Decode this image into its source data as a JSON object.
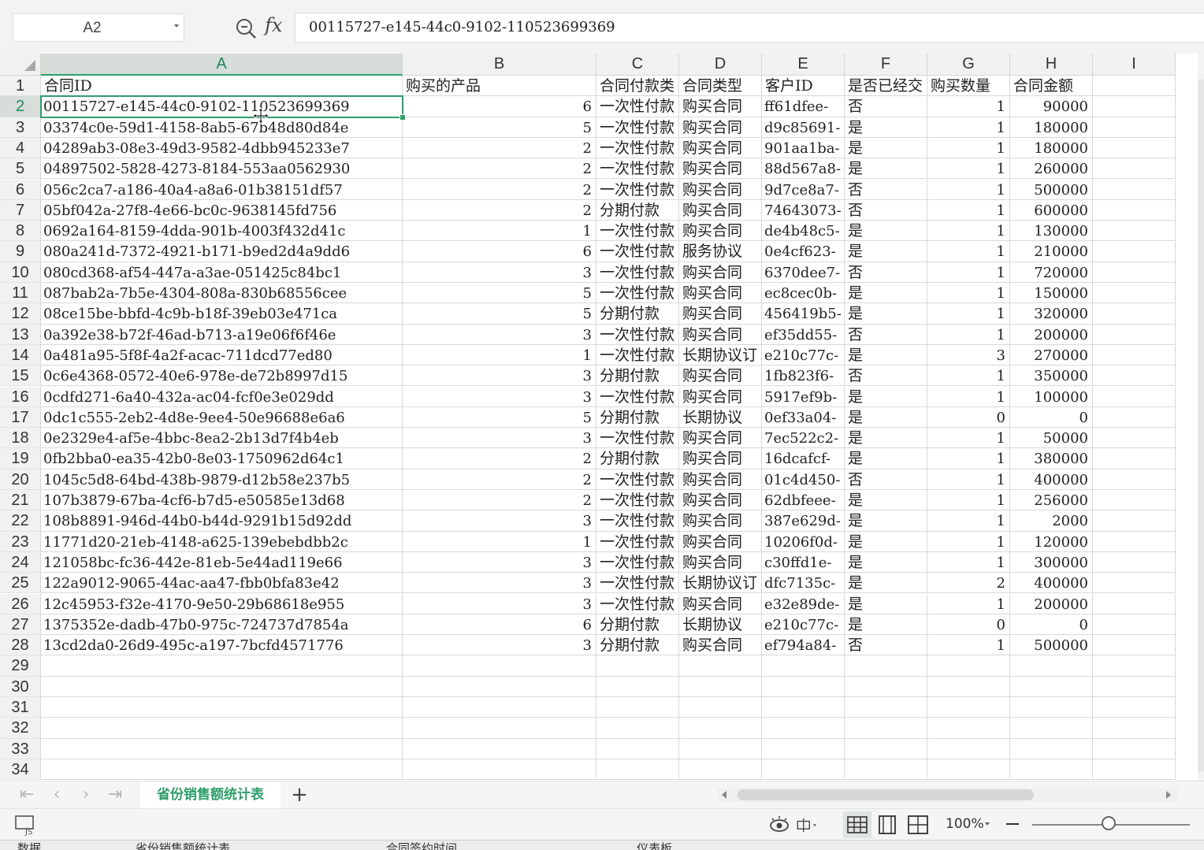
{
  "formula_bar": {
    "cell_ref": "A2",
    "fx_label": "fx",
    "formula_value": "00115727-e145-44c0-9102-110523699369"
  },
  "columns": [
    "A",
    "B",
    "C",
    "D",
    "E",
    "F",
    "G",
    "H",
    "I"
  ],
  "row_numbers": [
    "1",
    "2",
    "3",
    "4",
    "5",
    "6",
    "7",
    "8",
    "9",
    "10",
    "11",
    "12",
    "13",
    "14",
    "15",
    "16",
    "17",
    "18",
    "19",
    "20",
    "21",
    "22",
    "23",
    "24",
    "25",
    "26",
    "27",
    "28",
    "29",
    "30",
    "31",
    "32",
    "33",
    "34"
  ],
  "header_row": [
    "合同ID",
    "购买的产品",
    "合同付款类",
    "合同类型",
    "客户ID",
    "是否已经交",
    "购买数量",
    "合同金额"
  ],
  "rows": [
    [
      "00115727-e145-44c0-9102-110523699369",
      "6",
      "一次性付款",
      "购买合同",
      "ff61dfee-",
      "否",
      "1",
      "90000"
    ],
    [
      "03374c0e-59d1-4158-8ab5-67b48d80d84e",
      "5",
      "一次性付款",
      "购买合同",
      "d9c85691-",
      "是",
      "1",
      "180000"
    ],
    [
      "04289ab3-08e3-49d3-9582-4dbb945233e7",
      "2",
      "一次性付款",
      "购买合同",
      "901aa1ba-",
      "是",
      "1",
      "180000"
    ],
    [
      "04897502-5828-4273-8184-553aa0562930",
      "2",
      "一次性付款",
      "购买合同",
      "88d567a8-",
      "是",
      "1",
      "260000"
    ],
    [
      "056c2ca7-a186-40a4-a8a6-01b38151df57",
      "2",
      "一次性付款",
      "购买合同",
      "9d7ce8a7-",
      "否",
      "1",
      "500000"
    ],
    [
      "05bf042a-27f8-4e66-bc0c-9638145fd756",
      "2",
      "分期付款",
      "购买合同",
      "74643073-",
      "否",
      "1",
      "600000"
    ],
    [
      "0692a164-8159-4dda-901b-4003f432d41c",
      "1",
      "一次性付款",
      "购买合同",
      "de4b48c5-",
      "是",
      "1",
      "130000"
    ],
    [
      "080a241d-7372-4921-b171-b9ed2d4a9dd6",
      "6",
      "一次性付款",
      "服务协议",
      "0e4cf623-",
      "是",
      "1",
      "210000"
    ],
    [
      "080cd368-af54-447a-a3ae-051425c84bc1",
      "3",
      "一次性付款",
      "购买合同",
      "6370dee7-",
      "否",
      "1",
      "720000"
    ],
    [
      "087bab2a-7b5e-4304-808a-830b68556cee",
      "5",
      "一次性付款",
      "购买合同",
      "ec8cec0b-",
      "是",
      "1",
      "150000"
    ],
    [
      "08ce15be-bbfd-4c9b-b18f-39eb03e471ca",
      "5",
      "分期付款",
      "购买合同",
      "456419b5-",
      "是",
      "1",
      "320000"
    ],
    [
      "0a392e38-b72f-46ad-b713-a19e06f6f46e",
      "3",
      "一次性付款",
      "购买合同",
      "ef35dd55-",
      "否",
      "1",
      "200000"
    ],
    [
      "0a481a95-5f8f-4a2f-acac-711dcd77ed80",
      "1",
      "一次性付款",
      "长期协议订",
      "e210c77c-",
      "是",
      "3",
      "270000"
    ],
    [
      "0c6e4368-0572-40e6-978e-de72b8997d15",
      "3",
      "分期付款",
      "购买合同",
      "1fb823f6-",
      "否",
      "1",
      "350000"
    ],
    [
      "0cdfd271-6a40-432a-ac04-fcf0e3e029dd",
      "3",
      "一次性付款",
      "购买合同",
      "5917ef9b-",
      "是",
      "1",
      "100000"
    ],
    [
      "0dc1c555-2eb2-4d8e-9ee4-50e96688e6a6",
      "5",
      "分期付款",
      "长期协议",
      "0ef33a04-",
      "是",
      "0",
      "0"
    ],
    [
      "0e2329e4-af5e-4bbc-8ea2-2b13d7f4b4eb",
      "3",
      "一次性付款",
      "购买合同",
      "7ec522c2-",
      "是",
      "1",
      "50000"
    ],
    [
      "0fb2bba0-ea35-42b0-8e03-1750962d64c1",
      "2",
      "分期付款",
      "购买合同",
      "16dcafcf-",
      "是",
      "1",
      "380000"
    ],
    [
      "1045c5d8-64bd-438b-9879-d12b58e237b5",
      "2",
      "一次性付款",
      "购买合同",
      "01c4d450-",
      "否",
      "1",
      "400000"
    ],
    [
      "107b3879-67ba-4cf6-b7d5-e50585e13d68",
      "2",
      "一次性付款",
      "购买合同",
      "62dbfeee-",
      "是",
      "1",
      "256000"
    ],
    [
      "108b8891-946d-44b0-b44d-9291b15d92dd",
      "3",
      "一次性付款",
      "购买合同",
      "387e629d-",
      "是",
      "1",
      "2000"
    ],
    [
      "11771d20-21eb-4148-a625-139ebebdbb2c",
      "1",
      "一次性付款",
      "购买合同",
      "10206f0d-",
      "是",
      "1",
      "120000"
    ],
    [
      "121058bc-fc36-442e-81eb-5e44ad119e66",
      "3",
      "一次性付款",
      "购买合同",
      "c30ffd1e-",
      "是",
      "1",
      "300000"
    ],
    [
      "122a9012-9065-44ac-aa47-fbb0bfa83e42",
      "3",
      "一次性付款",
      "长期协议订",
      "dfc7135c-",
      "是",
      "2",
      "400000"
    ],
    [
      "12c45953-f32e-4170-9e50-29b68618e955",
      "3",
      "一次性付款",
      "购买合同",
      "e32e89de-",
      "是",
      "1",
      "200000"
    ],
    [
      "1375352e-dadb-47b0-975c-724737d7854a",
      "6",
      "分期付款",
      "长期协议",
      "e210c77c-",
      "是",
      "0",
      "0"
    ],
    [
      "13cd2da0-26d9-495c-a197-7bcfd4571776",
      "3",
      "分期付款",
      "购买合同",
      "ef794a84-",
      "否",
      "1",
      "500000"
    ]
  ],
  "sheet_tabs": {
    "active": "省份销售额统计表",
    "add_label": "+"
  },
  "status_bar": {
    "zoom_level": "100%"
  },
  "taskbar": {
    "items": [
      "数据",
      "省份销售额统计表",
      "合同签约时间",
      "仪表板"
    ]
  },
  "colors": {
    "accent": "#2e9e6a",
    "header_bg": "#f1f1f1",
    "active_header_bg": "#d7ddd9",
    "grid_line": "#d9d9d9"
  }
}
